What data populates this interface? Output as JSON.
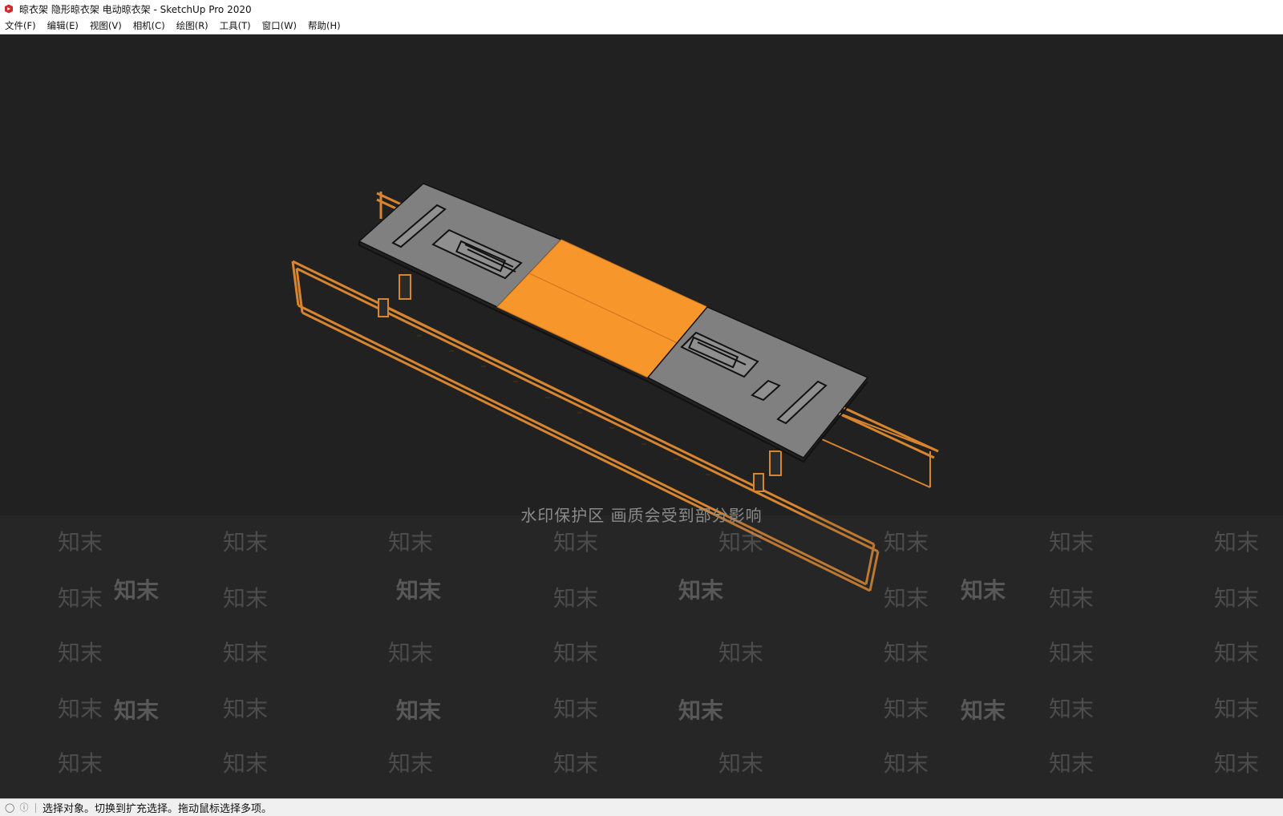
{
  "window": {
    "title": "晾衣架 隐形晾衣架 电动晾衣架 - SketchUp Pro 2020",
    "app_icon": "sketchup-icon",
    "accent_color": "#d42a2a"
  },
  "menu": {
    "items": [
      {
        "label": "文件(F)"
      },
      {
        "label": "编辑(E)"
      },
      {
        "label": "视图(V)"
      },
      {
        "label": "相机(C)"
      },
      {
        "label": "绘图(R)"
      },
      {
        "label": "工具(T)"
      },
      {
        "label": "窗口(W)"
      },
      {
        "label": "帮助(H)"
      }
    ]
  },
  "viewport": {
    "background": "#212121",
    "model": "drying-rack-3d-model",
    "panel_color": "#808080",
    "selected_color": "#f7962a",
    "frame_color": "#d88530"
  },
  "watermark": {
    "banner": "水印保护区  画质会受到部分影响",
    "brand": "知末"
  },
  "status": {
    "icons": [
      "info-bulb-icon",
      "help-circle-icon"
    ],
    "text": "选择对象。切换到扩充选择。拖动鼠标选择多项。"
  }
}
